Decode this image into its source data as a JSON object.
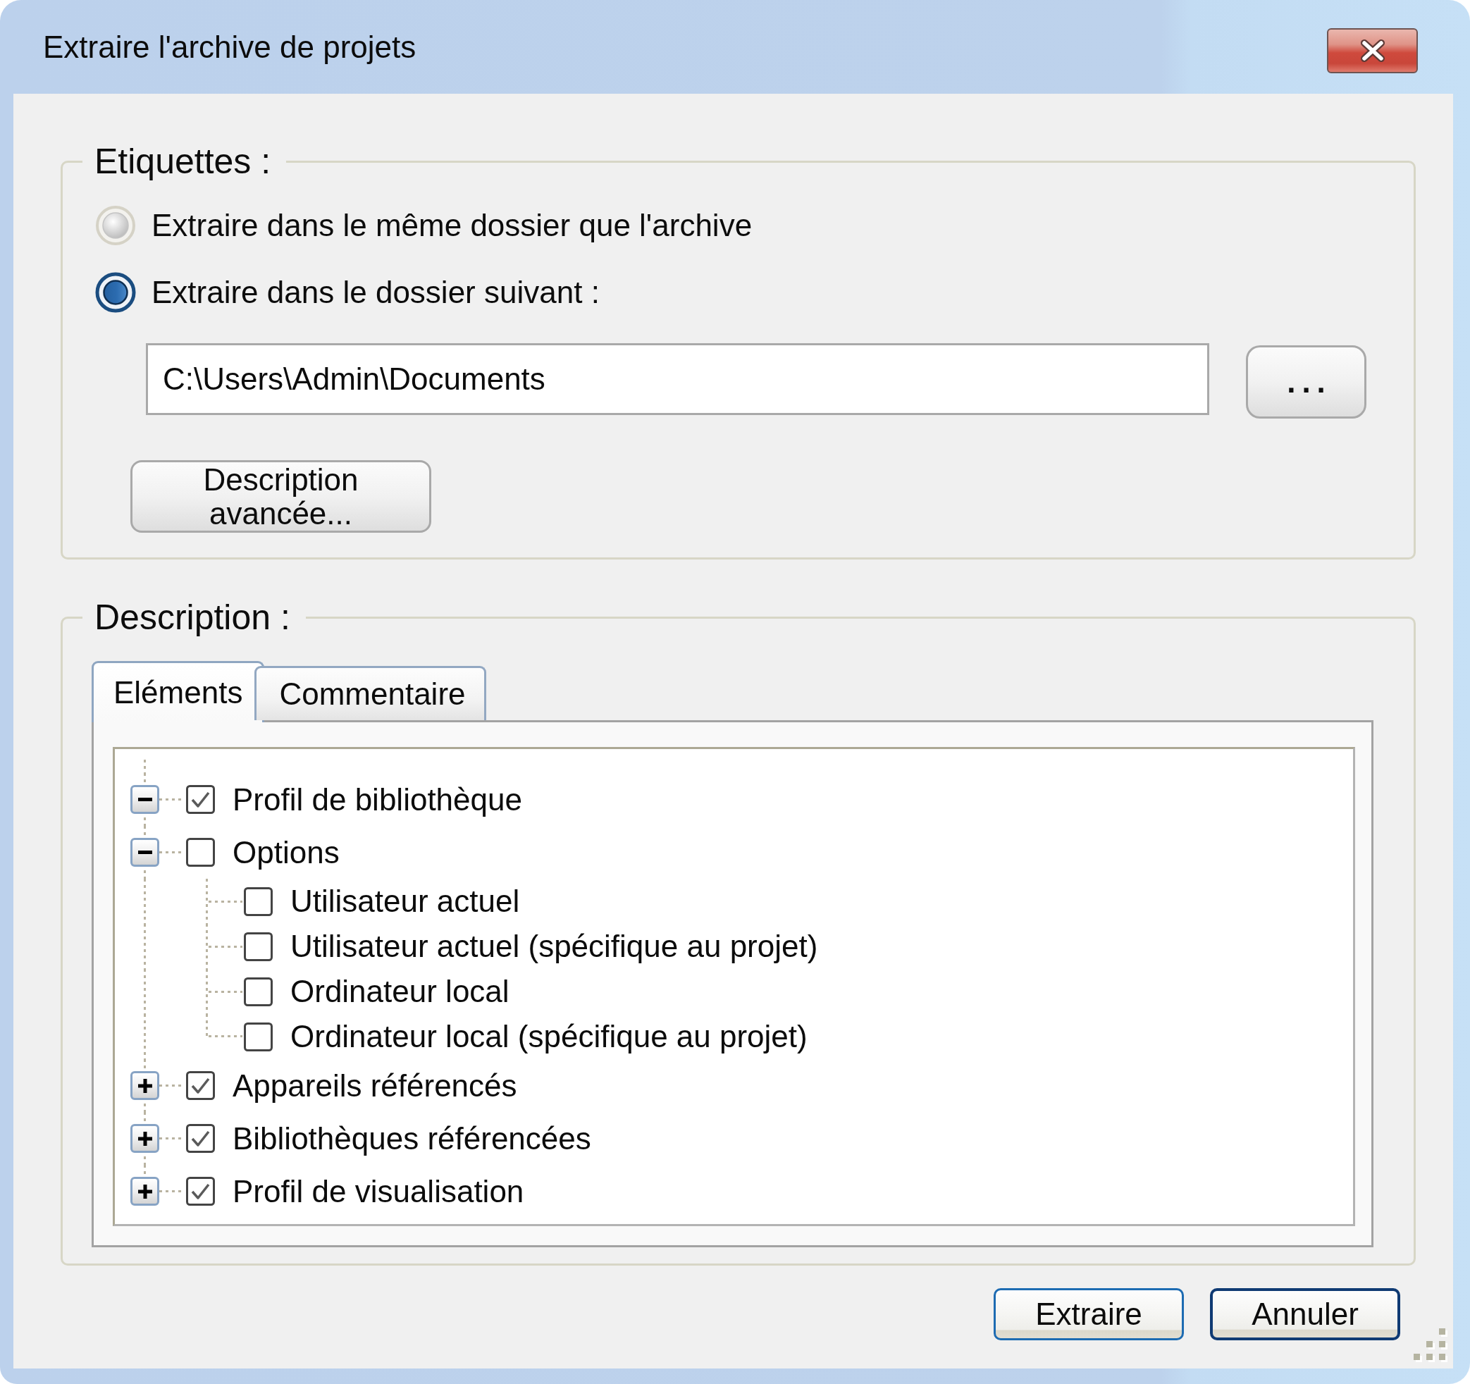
{
  "window": {
    "title": "Extraire l'archive de projets"
  },
  "labels_group": {
    "legend": "Etiquettes :",
    "options": [
      {
        "label": "Extraire dans le même dossier que l'archive",
        "selected": false
      },
      {
        "label": "Extraire dans le dossier suivant :",
        "selected": true
      }
    ],
    "folder_field": {
      "value": "C:\\Users\\Admin\\Documents"
    },
    "browse_button": "...",
    "advanced_button": "Description avancée..."
  },
  "description_group": {
    "legend": "Description :",
    "tabs": [
      {
        "label": "Eléments",
        "selected": true
      },
      {
        "label": "Commentaire",
        "selected": false
      }
    ],
    "tree": [
      {
        "label": "Profil de bibliothèque",
        "checked": true,
        "expanded": true
      },
      {
        "label": "Options",
        "checked": false,
        "expanded": true,
        "children": [
          {
            "label": "Utilisateur actuel",
            "checked": false
          },
          {
            "label": "Utilisateur actuel (spécifique au projet)",
            "checked": false
          },
          {
            "label": "Ordinateur local",
            "checked": false
          },
          {
            "label": "Ordinateur local (spécifique au projet)",
            "checked": false
          }
        ]
      },
      {
        "label": "Appareils référencés",
        "checked": true,
        "expanded": false
      },
      {
        "label": "Bibliothèques référencées",
        "checked": true,
        "expanded": false
      },
      {
        "label": "Profil de visualisation",
        "checked": true,
        "expanded": false
      }
    ]
  },
  "buttons": [
    {
      "label": "Extraire",
      "focused": false
    },
    {
      "label": "Annuler",
      "focused": true
    }
  ]
}
